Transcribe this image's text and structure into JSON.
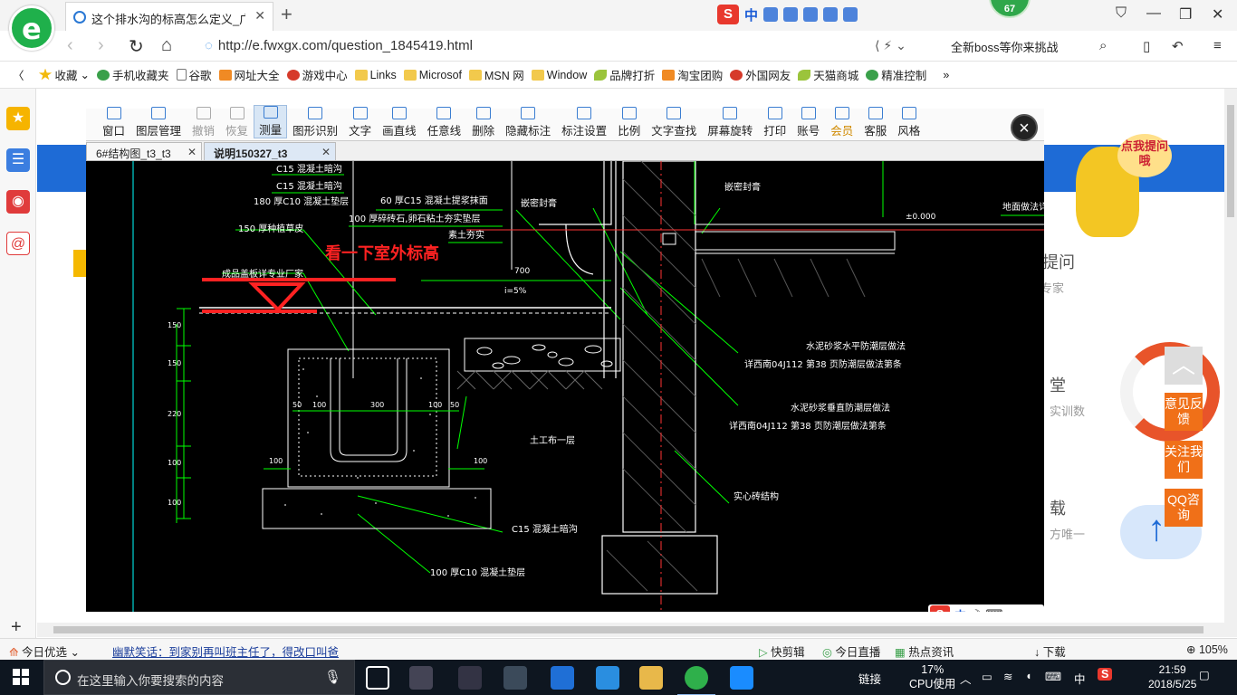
{
  "browser": {
    "tab_title": "这个排水沟的标高怎么定义_广联",
    "url": "http://e.fwxgx.com/question_1845419.html",
    "search_hint": "全新boss等你来挑战",
    "notify_count": "67",
    "sogou_label": "中",
    "favorites": [
      {
        "label": "收藏",
        "icon": "star-icon"
      },
      {
        "label": "手机收藏夹",
        "icon": "phone-icon"
      },
      {
        "label": "谷歌",
        "icon": "doc-icon"
      },
      {
        "label": "网址大全",
        "icon": "globe-icon"
      },
      {
        "label": "游戏中心",
        "icon": "game-icon"
      },
      {
        "label": "Links",
        "icon": "folder-icon"
      },
      {
        "label": "Microsof",
        "icon": "folder-icon"
      },
      {
        "label": "MSN 网",
        "icon": "folder-icon"
      },
      {
        "label": "Window",
        "icon": "folder-icon"
      },
      {
        "label": "品牌打折",
        "icon": "leaf-icon"
      },
      {
        "label": "淘宝团购",
        "icon": "taobao-icon"
      },
      {
        "label": "外国网友",
        "icon": "flag-icon"
      },
      {
        "label": "天猫商城",
        "icon": "leaf-icon"
      },
      {
        "label": "精准控制",
        "icon": "chat-icon"
      }
    ]
  },
  "viewer": {
    "toolbar": [
      "窗口",
      "图层管理",
      "撤销",
      "恢复",
      "测量",
      "图形识别",
      "文字",
      "画直线",
      "任意线",
      "删除",
      "隐藏标注",
      "标注设置",
      "比例",
      "文字查找",
      "屏幕旋转",
      "打印",
      "账号",
      "会员",
      "客服",
      "风格"
    ],
    "disabled": [
      "撤销",
      "恢复"
    ],
    "active": "测量",
    "tabs": [
      {
        "label": "6#结构图_t3_t3"
      },
      {
        "label": "说明150327_t3"
      }
    ],
    "close_label": "×",
    "ime_label": "中"
  },
  "drawing": {
    "annotation": "看一下室外标高",
    "labels": {
      "l1": "C15  混凝土暗沟",
      "l2": "180  厚C10  混凝土垫层",
      "l3": "150  厚种植草皮",
      "l4": "成品盖板详专业厂家",
      "l5": "60  厚C15  混凝土提浆抹面",
      "l6": "100  厚碎砖石,卵石粘土夯实垫层",
      "l7": "素土夯实",
      "l8": "嵌密封膏",
      "l9": "嵌密封膏",
      "l10": "地面做法详",
      "l11": "水泥砂浆水平防潮层做法",
      "l12": "详西南04J112    第38  页防潮层做法第条",
      "l13": "水泥砂浆垂直防潮层做法",
      "l14": "详西南04J112    第38  页防潮层做法第条",
      "l15": "土工布一层",
      "l16": "实心砖结构",
      "l17": "C15  混凝土暗沟",
      "l18": "100  厚C10  混凝土垫层",
      "l19": "±0.000",
      "l20": "i=5%",
      "l21": "700"
    },
    "dims": [
      "150",
      "150",
      "220",
      "100",
      "100",
      "50",
      "100",
      "300",
      "100",
      "50",
      "100",
      "100"
    ]
  },
  "page": {
    "right_items": [
      {
        "title": "提问",
        "sub": "专家"
      },
      {
        "title": "堂",
        "sub": "实训数"
      },
      {
        "title": "载",
        "sub": "方唯一"
      }
    ],
    "mascot_bubble": "点我提问哦",
    "feedback_buttons": [
      "意见反馈",
      "关注我们",
      "QQ咨询"
    ]
  },
  "statusbar": {
    "items": [
      "今日优选",
      "幽默笑话：到家别再叫班主任了，得改口叫爸",
      "快剪辑",
      "今日直播",
      "热点资讯",
      "下载",
      "105%"
    ]
  },
  "taskbar": {
    "search_placeholder": "在这里输入你要搜索的内容",
    "tray_link": "链接",
    "cpu": "17%",
    "cpu_label": "CPU使用",
    "ime": "中",
    "time": "21:59",
    "date": "2018/5/25"
  }
}
